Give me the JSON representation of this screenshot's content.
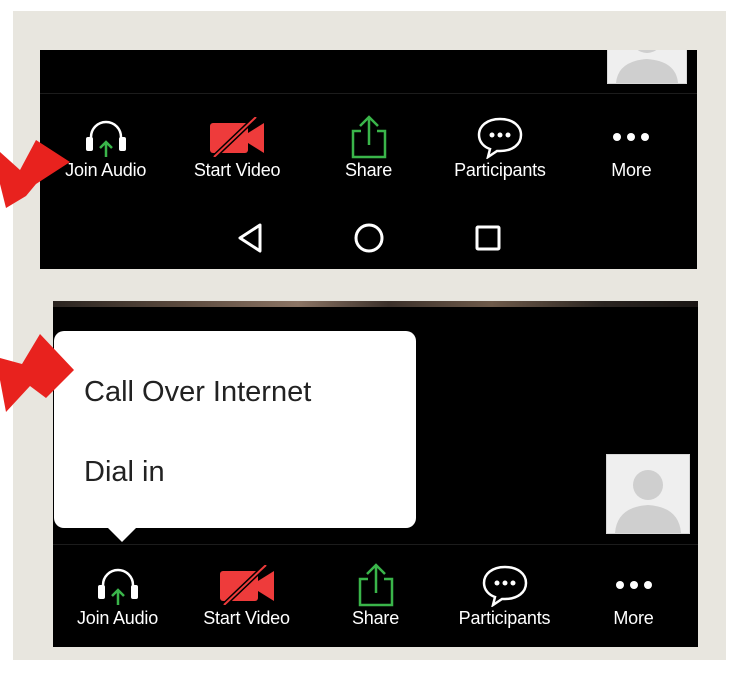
{
  "top_toolbar": {
    "items": [
      {
        "label": "Join Audio",
        "icon": "headphones-join-icon"
      },
      {
        "label": "Start Video",
        "icon": "video-off-icon"
      },
      {
        "label": "Share",
        "icon": "share-upload-icon"
      },
      {
        "label": "Participants",
        "icon": "chat-bubble-icon"
      },
      {
        "label": "More",
        "icon": "more-dots-icon"
      }
    ]
  },
  "android_nav": {
    "buttons": [
      "back-triangle-icon",
      "home-circle-icon",
      "recents-square-icon"
    ]
  },
  "audio_popup": {
    "items": [
      "Call Over Internet",
      "Dial in"
    ]
  },
  "bottom_toolbar": {
    "items": [
      {
        "label": "Join Audio",
        "icon": "headphones-join-icon"
      },
      {
        "label": "Start Video",
        "icon": "video-off-icon"
      },
      {
        "label": "Share",
        "icon": "share-upload-icon"
      },
      {
        "label": "Participants",
        "icon": "chat-bubble-icon"
      },
      {
        "label": "More",
        "icon": "more-dots-icon"
      }
    ]
  },
  "colors": {
    "toolbar_bg": "#000000",
    "video_off_red": "#ee3b3b",
    "share_green": "#3ab54a",
    "join_arrow_green": "#3ab54a",
    "annotation_arrow_red": "#e8221e",
    "frame_bg": "#e8e6df"
  }
}
